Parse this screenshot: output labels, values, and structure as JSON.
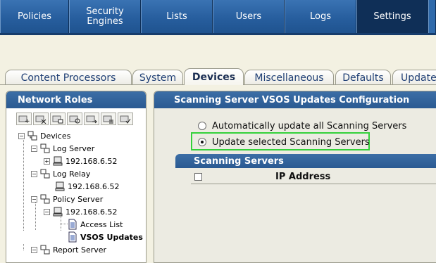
{
  "topnav": {
    "items": [
      {
        "label": "Policies"
      },
      {
        "label": "Security\nEngines"
      },
      {
        "label": "Lists"
      },
      {
        "label": "Users"
      },
      {
        "label": "Logs"
      },
      {
        "label": "Settings",
        "active": true
      }
    ]
  },
  "tabs": [
    {
      "label": "Content Processors"
    },
    {
      "label": "System"
    },
    {
      "label": "Devices",
      "active": true
    },
    {
      "label": "Miscellaneous"
    },
    {
      "label": "Defaults"
    },
    {
      "label": "Updates"
    }
  ],
  "left_panel": {
    "title": "Network Roles",
    "toolbar_icons": [
      "add-device-icon",
      "delete-device-icon",
      "edit-device-icon",
      "refresh-device-icon",
      "move-device-icon",
      "list-device-icon",
      "check-device-icon"
    ],
    "tree": {
      "devices": "Devices",
      "log_server": "Log Server",
      "log_server_ip": "192.168.6.52",
      "log_relay": "Log Relay",
      "log_relay_ip": "192.168.6.52",
      "policy_server": "Policy Server",
      "policy_server_ip": "192.168.6.52",
      "access_list": "Access List",
      "vsos_updates": "VSOS Updates",
      "report_server": "Report Server"
    }
  },
  "right_panel": {
    "title": "Scanning Server VSOS Updates Configuration",
    "radio_auto": "Automatically update all Scanning Servers",
    "radio_selected": "Update selected Scanning Servers",
    "selected_option": "selected",
    "section_title": "Scanning Servers",
    "column_ip": "IP Address"
  },
  "colors": {
    "nav_blue": "#1b4f8c",
    "header_blue": "#2a5a92",
    "highlight_green": "#34d13a",
    "panel_bg": "#ecebe2",
    "page_bg": "#f3f1e2"
  }
}
